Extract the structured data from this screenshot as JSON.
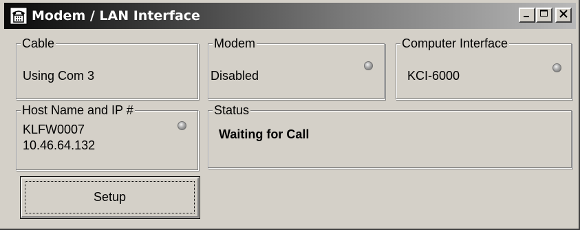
{
  "window": {
    "title": "Modem / LAN Interface",
    "title_icon": "telephone-icon",
    "controls": {
      "minimize": "minimize-icon",
      "maximize": "maximize-icon",
      "close": "close-icon"
    }
  },
  "groups": {
    "cable": {
      "legend": "Cable",
      "value": "Using Com 3"
    },
    "modem": {
      "legend": "Modem",
      "value": "Disabled",
      "indicator": "status-led-icon"
    },
    "computer_interface": {
      "legend": "Computer Interface",
      "value": "KCI-6000",
      "indicator": "status-led-icon"
    },
    "host": {
      "legend": "Host Name and IP #",
      "host_name": "KLFW0007",
      "ip": "10.46.64.132",
      "indicator": "status-led-icon"
    },
    "status": {
      "legend": "Status",
      "value": "Waiting for Call"
    }
  },
  "buttons": {
    "setup": "Setup"
  },
  "colors": {
    "face": "#d4d0c8",
    "titlebar_start": "#0a0a0a",
    "titlebar_end": "#b8b8b8",
    "led": "#a8a8a8"
  }
}
